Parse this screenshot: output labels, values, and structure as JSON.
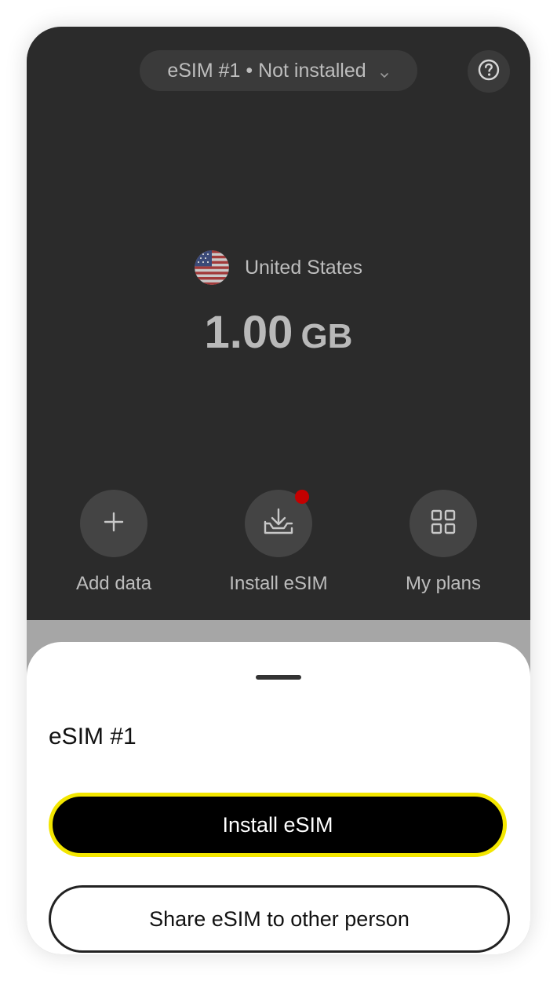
{
  "header": {
    "esim_selector_label": "eSIM #1 • Not installed",
    "help_icon": "question-circle-icon"
  },
  "plan": {
    "country": "United States",
    "flag_icon": "us-flag-icon",
    "amount_value": "1.00",
    "amount_unit": "GB"
  },
  "actions": [
    {
      "label": "Add data",
      "icon": "plus-icon"
    },
    {
      "label": "Install eSIM",
      "icon": "download-tray-icon",
      "notification_dot": true
    },
    {
      "label": "My plans",
      "icon": "grid-icon"
    }
  ],
  "sheet": {
    "title": "eSIM #1",
    "primary_button": "Install eSIM",
    "secondary_button": "Share eSIM to other person"
  },
  "colors": {
    "top_background": "#2b2b2b",
    "scrim": "#a6a6a6",
    "highlight_outline": "#f3e600",
    "notification_dot": "#c40000"
  }
}
